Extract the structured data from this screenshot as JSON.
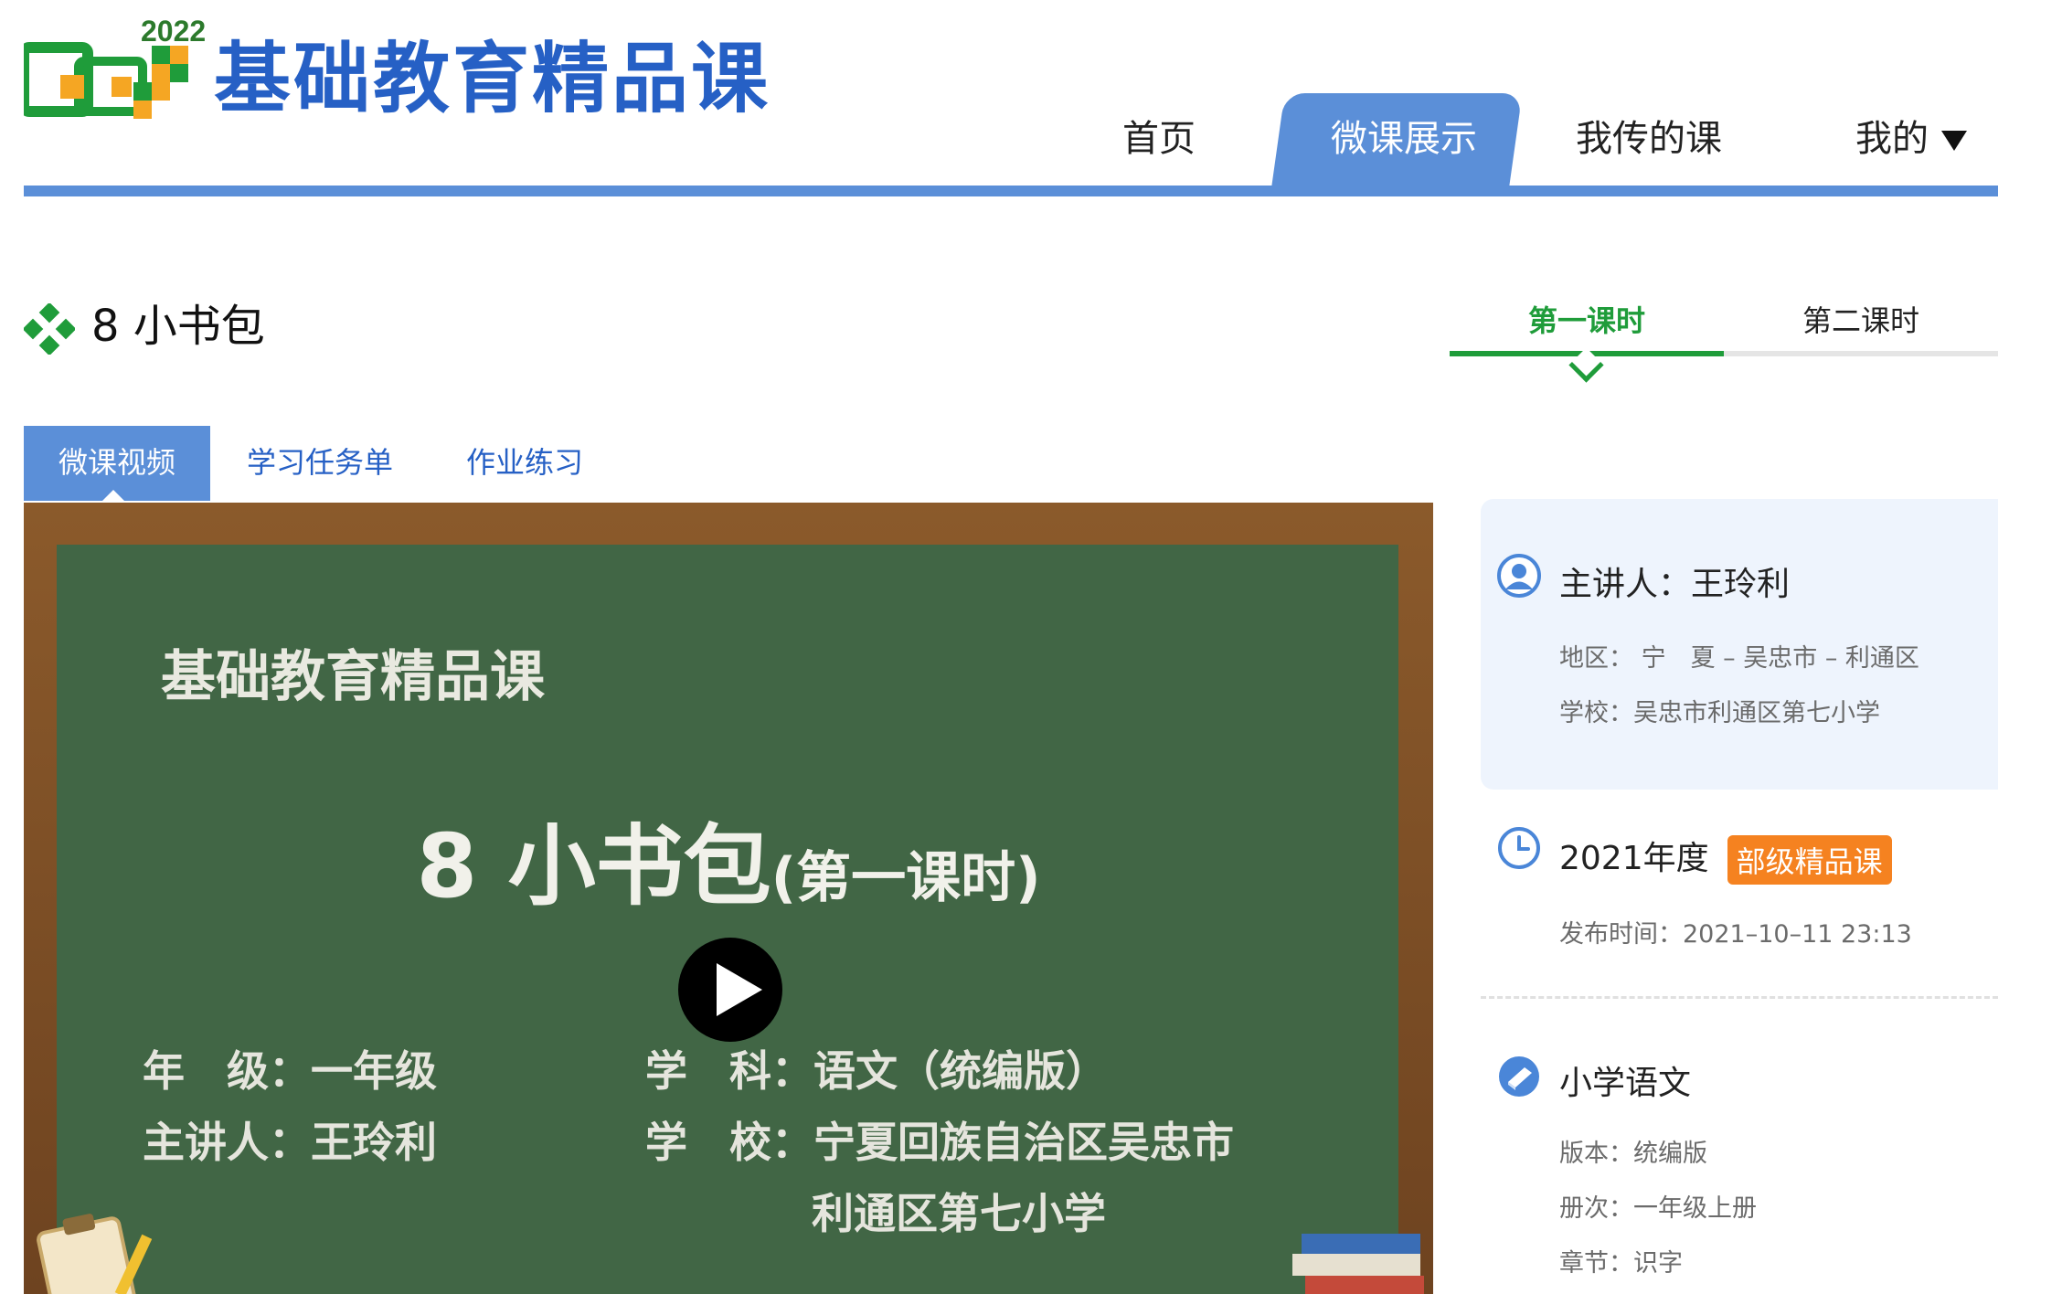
{
  "brand": {
    "year": "2022",
    "title": "基础教育精品课"
  },
  "nav": {
    "items": [
      {
        "label": "首页"
      },
      {
        "label": "微课展示"
      },
      {
        "label": "我传的课"
      },
      {
        "label": "我的"
      }
    ],
    "active_index": 1
  },
  "page": {
    "title": "8 小书包"
  },
  "lesson_tabs": [
    {
      "label": "第一课时"
    },
    {
      "label": "第二课时"
    }
  ],
  "content_tabs": [
    {
      "label": "微课视频"
    },
    {
      "label": "学习任务单"
    },
    {
      "label": "作业练习"
    }
  ],
  "video": {
    "brand": "基础教育精品课",
    "title": "8 小书包",
    "title_suffix": "(第一课时)",
    "grade": "年　级：一年级",
    "teacher": "主讲人：王玲利",
    "subject": "学　科：语文（统编版）",
    "school_line1": "学　校：宁夏回族自治区吴忠市",
    "school_line2": "利通区第七小学"
  },
  "info": {
    "presenter": "主讲人：王玲利",
    "region": "地区：  宁　夏 – 吴忠市 – 利通区",
    "school": "学校：吴忠市利通区第七小学",
    "year": "2021年度",
    "badge": "部级精品课",
    "published": "发布时间：2021–10–11 23:13",
    "subject": "小学语文",
    "edition": "版本：统编版",
    "volume": "册次：一年级上册",
    "chapter": "章节：识字"
  },
  "colors": {
    "brand_blue": "#2660c5",
    "nav_blue": "#5b8fd8",
    "green": "#1f9c3a",
    "board_green": "#416645",
    "badge_orange": "#f58220"
  }
}
